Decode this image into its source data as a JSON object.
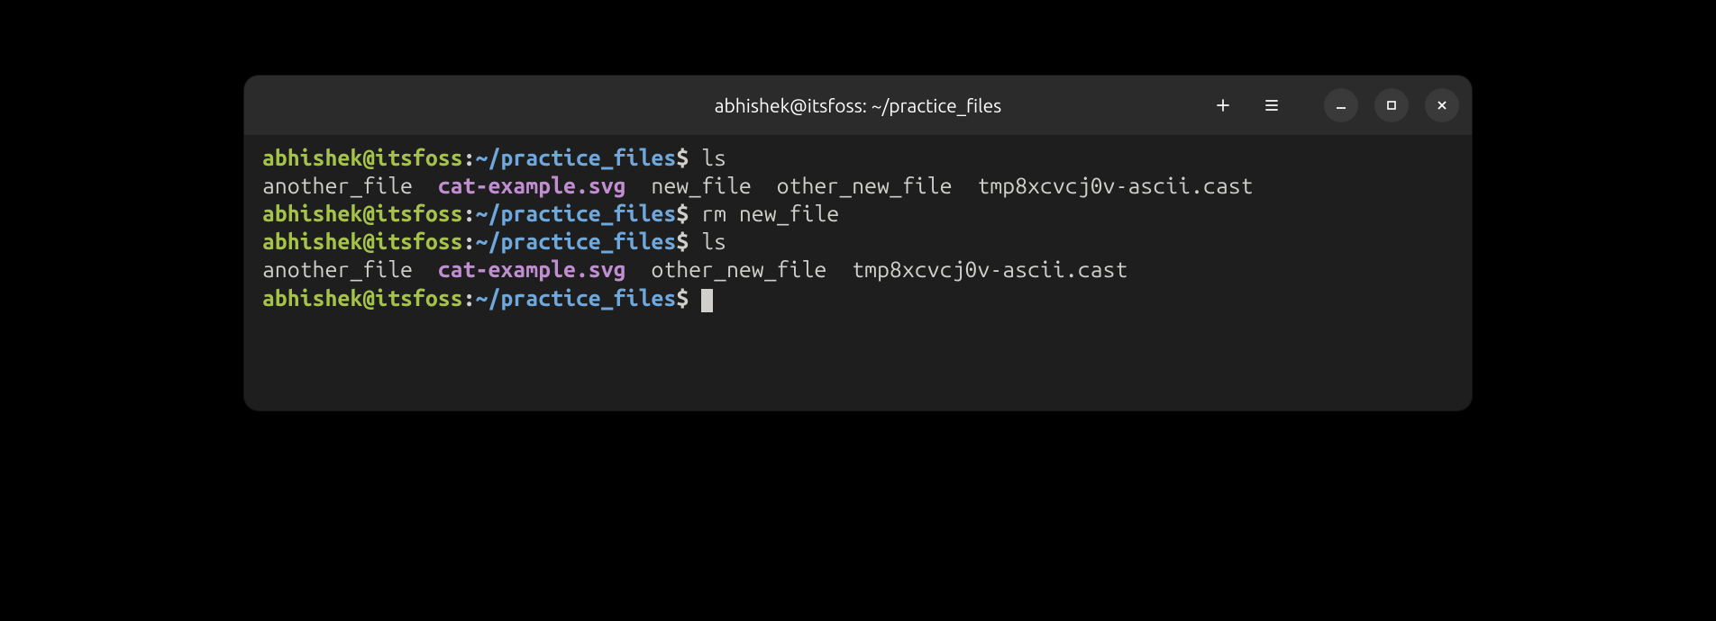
{
  "titlebar": {
    "title": "abhishek@itsfoss: ~/practice_files"
  },
  "prompt": {
    "user_host": "abhishek@itsfoss",
    "colon": ":",
    "path": "~/practice_files",
    "dollar": "$"
  },
  "lines": [
    {
      "type": "prompt",
      "cmd": " ls"
    },
    {
      "type": "output-files",
      "segments": [
        {
          "text": "another_file  ",
          "class": "file-normal"
        },
        {
          "text": "cat-example.svg",
          "class": "file-image"
        },
        {
          "text": "  new_file  other_new_file  tmp8xcvcj0v-ascii.cast",
          "class": "file-normal"
        }
      ]
    },
    {
      "type": "prompt",
      "cmd": " rm new_file"
    },
    {
      "type": "prompt",
      "cmd": " ls"
    },
    {
      "type": "output-files",
      "segments": [
        {
          "text": "another_file  ",
          "class": "file-normal"
        },
        {
          "text": "cat-example.svg",
          "class": "file-image"
        },
        {
          "text": "  other_new_file  tmp8xcvcj0v-ascii.cast",
          "class": "file-normal"
        }
      ]
    },
    {
      "type": "prompt-cursor",
      "cmd": " "
    }
  ]
}
